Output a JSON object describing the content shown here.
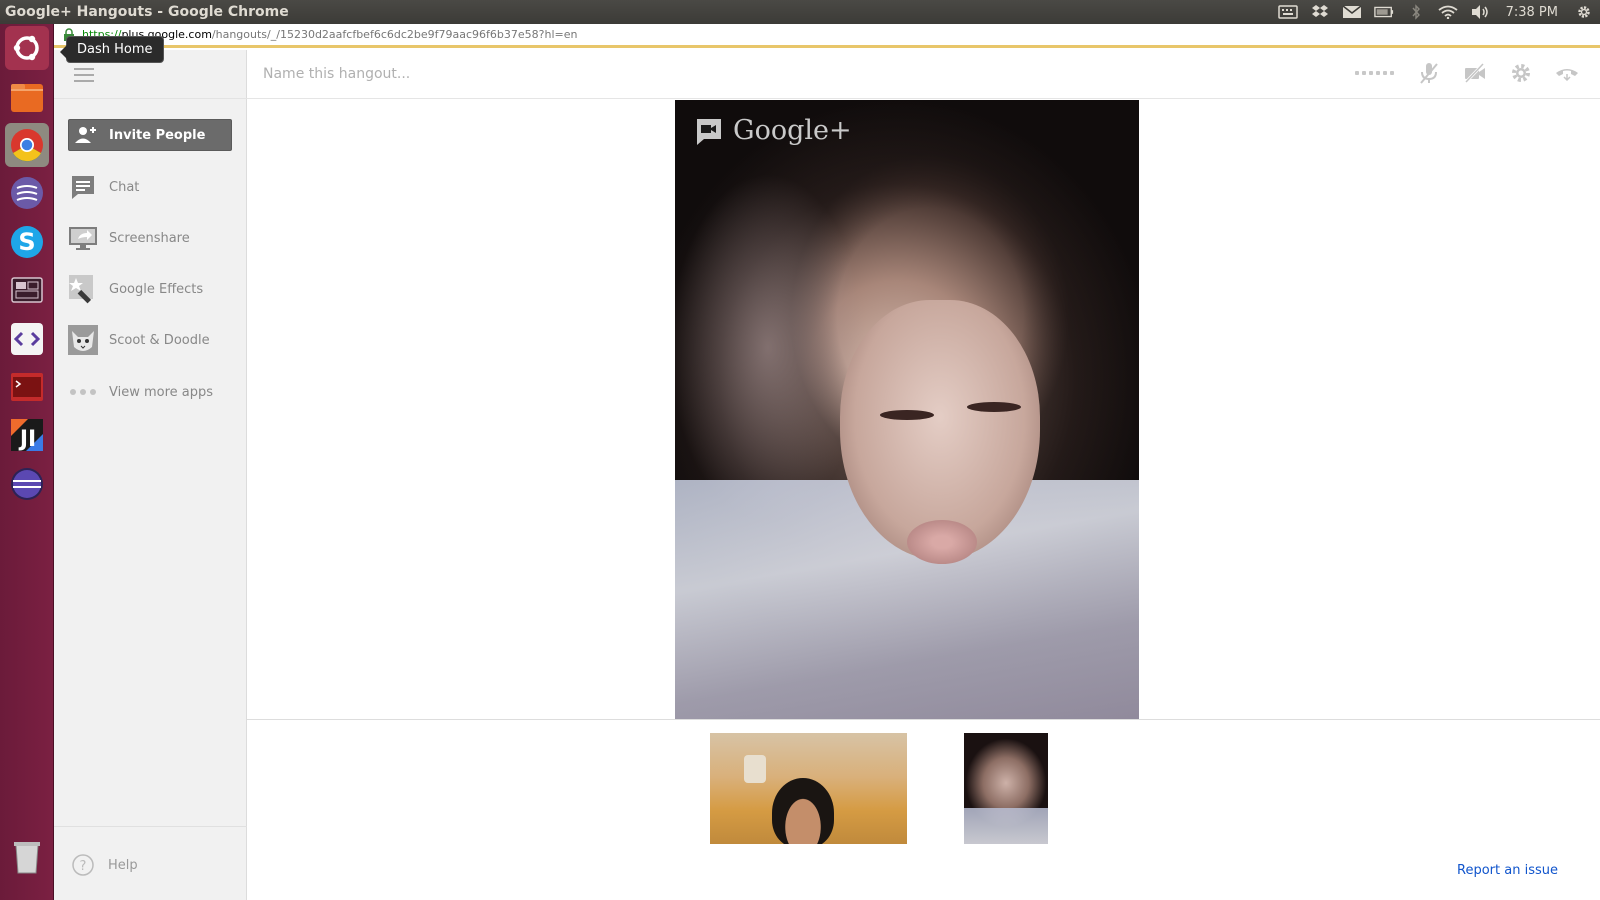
{
  "window": {
    "title": "Google+ Hangouts - Google Chrome",
    "clock": "7:38 PM"
  },
  "tray_icons": [
    "keyboard-icon",
    "dropbox-icon",
    "mail-icon",
    "battery-icon",
    "bluetooth-icon",
    "wifi-icon",
    "volume-icon"
  ],
  "launcher": {
    "tooltip": "Dash Home",
    "items": [
      "dash-home",
      "files",
      "chrome",
      "gedit",
      "skype",
      "workspaces",
      "brackets",
      "terminal",
      "intellij",
      "eclipse",
      "trash"
    ]
  },
  "browser": {
    "url_scheme": "https://",
    "url_host": "plus.google.com",
    "url_path": "/hangouts/_/15230d2aafcfbef6c6dc2be9f79aac96f6b37e58?hl=en"
  },
  "sidebar": {
    "invite_label": "Invite People",
    "apps": [
      {
        "label": "Chat",
        "icon": "chat-icon"
      },
      {
        "label": "Screenshare",
        "icon": "screenshare-icon"
      },
      {
        "label": "Google Effects",
        "icon": "effects-icon"
      },
      {
        "label": "Scoot & Doodle",
        "icon": "scoot-doodle-icon"
      },
      {
        "label": "View more apps",
        "icon": "more-dots-icon"
      }
    ],
    "help_label": "Help"
  },
  "hangout": {
    "name_placeholder": "Name this hangout...",
    "brand_text": "Google+",
    "controls": [
      "signal-bars-icon",
      "mute-mic-icon",
      "camera-off-icon",
      "settings-icon",
      "hang-up-icon"
    ]
  },
  "footer": {
    "report_label": "Report an issue"
  },
  "colors": {
    "launcher_bg": "#7b2042",
    "invite_bg": "#6b6b6b",
    "link": "#1155cc",
    "url_bar_accent": "#e8c66a"
  }
}
